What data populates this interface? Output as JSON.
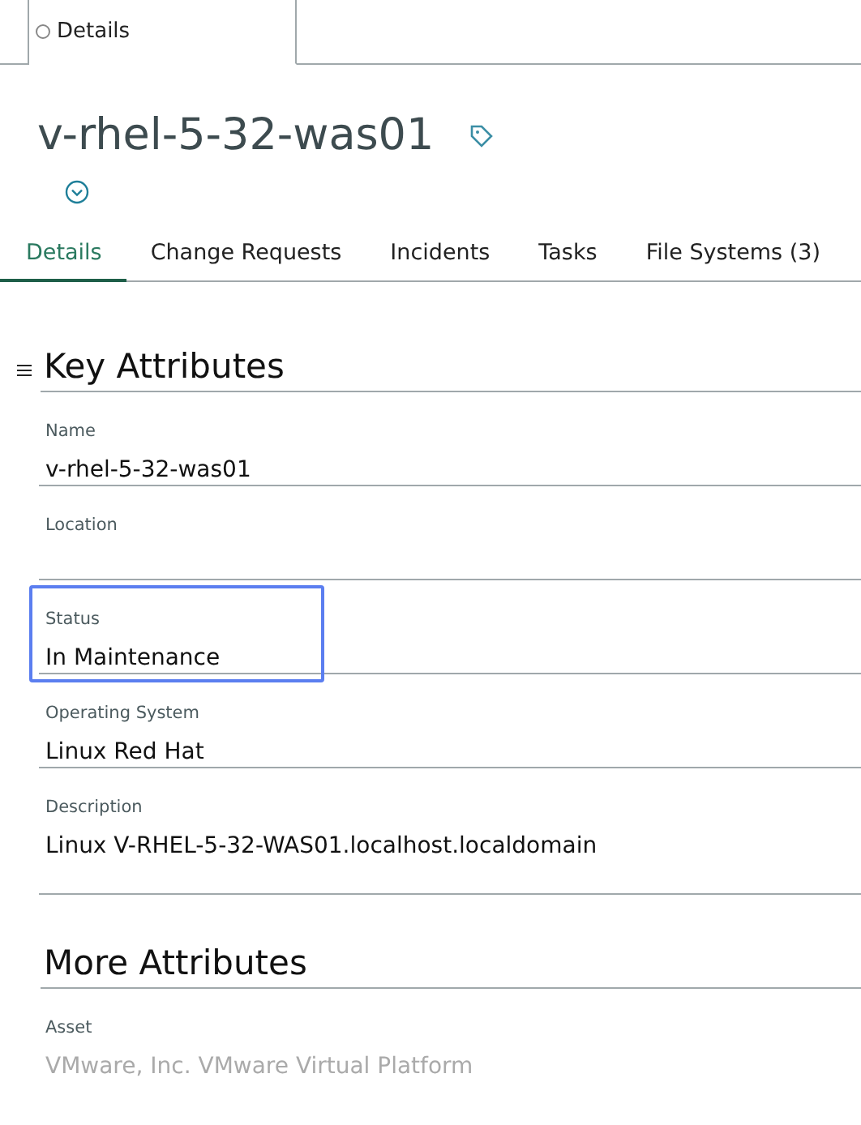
{
  "top_tabs": [
    {
      "label": "Details",
      "selected": true
    }
  ],
  "title": "v-rhel-5-32-was01",
  "tabs": [
    {
      "label": "Details",
      "selected": true
    },
    {
      "label": "Change Requests",
      "selected": false
    },
    {
      "label": "Incidents",
      "selected": false
    },
    {
      "label": "Tasks",
      "selected": false
    },
    {
      "label": "File Systems (3)",
      "selected": false
    }
  ],
  "sections": [
    {
      "heading": "Key Attributes",
      "collapsible": true,
      "fields": [
        {
          "label": "Name",
          "value": "v-rhel-5-32-was01",
          "focused": false,
          "disabled": false
        },
        {
          "label": "Location",
          "focused": false
        },
        {
          "label": "Status",
          "value": "In Maintenance",
          "focused": true,
          "disabled": false
        },
        {
          "label": "Operating System",
          "value": "Linux Red Hat",
          "focused": false,
          "disabled": false
        },
        {
          "label": "Description",
          "value": "Linux V-RHEL-5-32-WAS01.localhost.localdomain",
          "focused": false,
          "disabled": false,
          "multiline": true
        }
      ]
    },
    {
      "heading": "More Attributes",
      "collapsible": false,
      "fields": [
        {
          "label": "Asset",
          "value": "VMware, Inc. VMware Virtual Platform",
          "focused": false,
          "disabled": true
        }
      ]
    }
  ]
}
